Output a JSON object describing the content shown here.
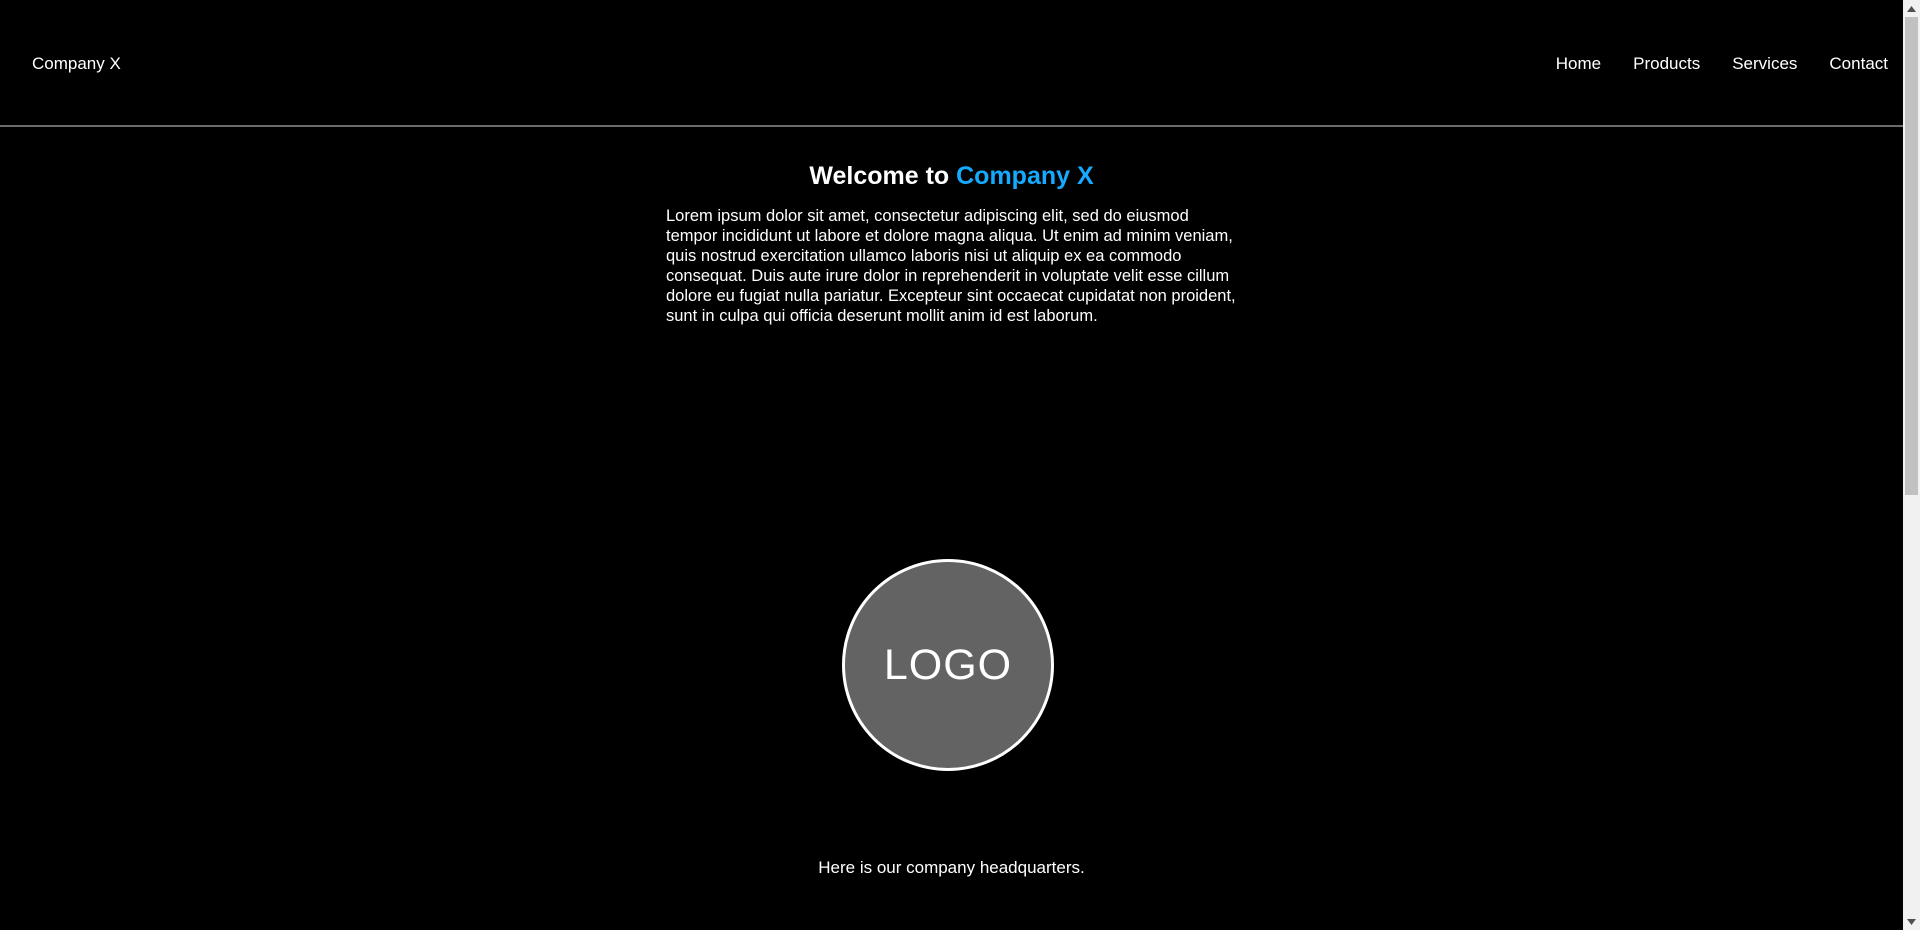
{
  "header": {
    "brand": "Company X",
    "nav": [
      "Home",
      "Products",
      "Services",
      "Contact"
    ]
  },
  "hero": {
    "title_prefix": "Welcome to ",
    "title_accent": "Company X",
    "intro": "Lorem ipsum dolor sit amet, consectetur adipiscing elit, sed do eiusmod tempor incididunt ut labore et dolore magna aliqua. Ut enim ad minim veniam, quis nostrud exercitation ullamco laboris nisi ut aliquip ex ea commodo consequat. Duis aute irure dolor in reprehenderit in voluptate velit esse cillum dolore eu fugiat nulla pariatur. Excepteur sint occaecat cupidatat non proident, sunt in culpa qui officia deserunt mollit anim id est laborum."
  },
  "logo": {
    "text": "LOGO"
  },
  "caption": "Here is our company headquarters.",
  "colors": {
    "background": "#000000",
    "accent": "#16aaff",
    "logo_fill": "#636363",
    "divider": "#6b6b6b"
  },
  "icons": {
    "scroll_up": "triangle-up-icon",
    "scroll_down": "triangle-down-icon"
  }
}
